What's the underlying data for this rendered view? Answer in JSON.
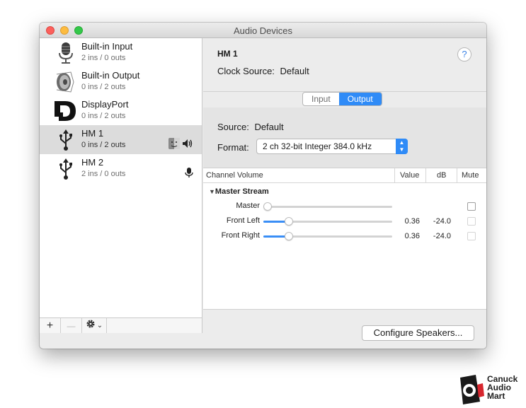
{
  "window": {
    "title": "Audio Devices"
  },
  "sidebar": {
    "devices": [
      {
        "name": "Built-in Input",
        "io": "2 ins / 0 outs",
        "icon": "microphone-icon",
        "selected": false
      },
      {
        "name": "Built-in Output",
        "io": "0 ins / 2 outs",
        "icon": "speaker-icon",
        "selected": false
      },
      {
        "name": "DisplayPort",
        "io": "0 ins / 2 outs",
        "icon": "displayport-icon",
        "selected": false
      },
      {
        "name": "HM 1",
        "io": "0 ins / 2 outs",
        "icon": "usb-icon",
        "selected": true,
        "badges": [
          "finder-icon",
          "sound-output-icon"
        ]
      },
      {
        "name": "HM 2",
        "io": "2 ins / 0 outs",
        "icon": "usb-icon",
        "selected": false,
        "badges": [
          "sound-input-icon"
        ]
      }
    ],
    "toolbar": {
      "add_label": "+",
      "remove_label": "—",
      "gear_icon": "gear-icon",
      "chevron": "⌄"
    }
  },
  "detail": {
    "device_title": "HM 1",
    "clock_source_label": "Clock Source:",
    "clock_source_value": "Default",
    "help_label": "?",
    "tabs": [
      {
        "label": "Input",
        "active": false
      },
      {
        "label": "Output",
        "active": true
      }
    ],
    "source_label": "Source:",
    "source_value": "Default",
    "format_label": "Format:",
    "format_value": "2 ch 32-bit Integer 384.0 kHz",
    "table": {
      "headers": {
        "channel": "Channel Volume",
        "value": "Value",
        "db": "dB",
        "mute": "Mute"
      },
      "stream": "Master Stream",
      "channels": [
        {
          "name": "Master",
          "level": 0,
          "value": "",
          "db": "",
          "mute_enabled": true
        },
        {
          "name": "Front Left",
          "level": 0.36,
          "value": "0.36",
          "db": "-24.0",
          "mute_enabled": false
        },
        {
          "name": "Front Right",
          "level": 0.36,
          "value": "0.36",
          "db": "-24.0",
          "mute_enabled": false
        }
      ]
    },
    "configure_label": "Configure Speakers..."
  },
  "watermark": {
    "lines": [
      "Canuck",
      "Audio",
      "Mart"
    ]
  },
  "colors": {
    "accent": "#2f8bf7",
    "close": "#fc605c",
    "minimize": "#fdbc40",
    "maximize": "#34c84a"
  }
}
